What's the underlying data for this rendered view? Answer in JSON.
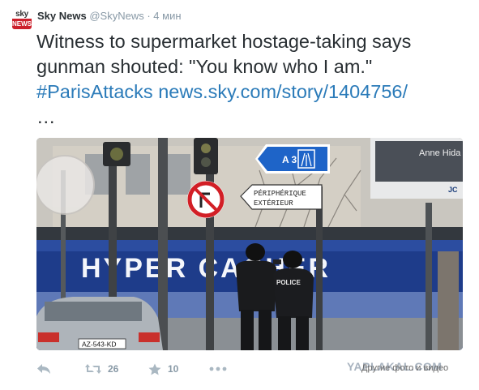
{
  "account": {
    "avatar_top": "sky",
    "avatar_bottom": "NEWS",
    "name": "Sky News",
    "handle": "@SkyNews",
    "separator": "·",
    "time": "4 мин"
  },
  "tweet": {
    "text": "Witness to supermarket hostage-taking says gunman shouted: \"You know who I am.\"",
    "hashtag": "#ParisAttacks",
    "link": "news.sky.com/story/1404756/",
    "ellipsis": "…"
  },
  "photo": {
    "sign_a3": "A 3",
    "sign_periph_line1": "PÉRIPHÉRIQUE",
    "sign_periph_line2": "EXTÉRIEUR",
    "storefront": "HYPER CACHER",
    "police_label": "POLICE",
    "plate": "AZ-543-KD",
    "billboard": "Anne Hida",
    "billboard_corner": "JC"
  },
  "actions": {
    "reply_icon": "reply-icon",
    "retweet_icon": "retweet-icon",
    "retweet_count": "26",
    "favorite_icon": "star-icon",
    "favorite_count": "10",
    "more_icon": "ellipsis-icon"
  },
  "footer": {
    "watermark": "YAPLAKAL.COM",
    "more_media": "Другие фото и видео"
  },
  "colors": {
    "link": "#2b7bb9",
    "text": "#292f33",
    "muted": "#8899a6",
    "icon": "#aab8c2",
    "sky_red": "#cc1f2b",
    "sign_blue": "#1e64c8"
  }
}
